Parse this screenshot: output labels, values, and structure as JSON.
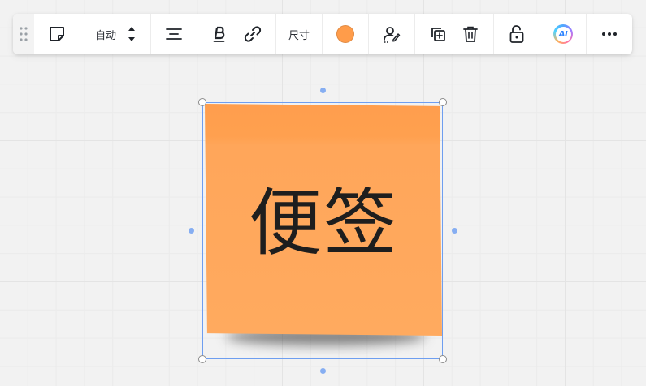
{
  "toolbar": {
    "type_tooltip": "sticky-note",
    "auto_label": "自动",
    "size_label": "尺寸",
    "ai_label": "AI"
  },
  "sticky": {
    "text": "便签",
    "color": "#ffa24f"
  },
  "icons": {
    "drag": "drag-handle-icon",
    "note": "sticky-note-icon",
    "updown": "up-down-stepper-icon",
    "align": "align-center-icon",
    "bold": "bold-icon",
    "link": "link-icon",
    "signature": "user-signature-icon",
    "duplicate": "duplicate-icon",
    "delete": "trash-icon",
    "lock": "unlock-icon",
    "more": "more-icon"
  }
}
